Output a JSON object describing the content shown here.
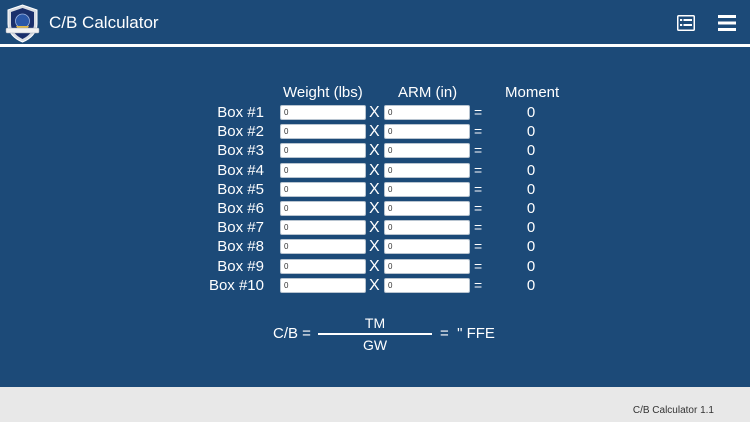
{
  "header": {
    "title": "C/B Calculator",
    "logo_icon": "air-force-shield-emblem",
    "list_icon": "list-view-icon",
    "menu_icon": "hamburger-menu-icon",
    "background_color": "#1c4a78"
  },
  "columns": {
    "weight": "Weight (lbs)",
    "arm": "ARM (in)",
    "moment": "Moment"
  },
  "rows": [
    {
      "label": "Box #1",
      "weight": "0",
      "arm": "0",
      "times": "X",
      "equals": "=",
      "moment": "0"
    },
    {
      "label": "Box #2",
      "weight": "0",
      "arm": "0",
      "times": "X",
      "equals": "=",
      "moment": "0"
    },
    {
      "label": "Box #3",
      "weight": "0",
      "arm": "0",
      "times": "X",
      "equals": "=",
      "moment": "0"
    },
    {
      "label": "Box #4",
      "weight": "0",
      "arm": "0",
      "times": "X",
      "equals": "=",
      "moment": "0"
    },
    {
      "label": "Box #5",
      "weight": "0",
      "arm": "0",
      "times": "X",
      "equals": "=",
      "moment": "0"
    },
    {
      "label": "Box #6",
      "weight": "0",
      "arm": "0",
      "times": "X",
      "equals": "=",
      "moment": "0"
    },
    {
      "label": "Box #7",
      "weight": "0",
      "arm": "0",
      "times": "X",
      "equals": "=",
      "moment": "0"
    },
    {
      "label": "Box #8",
      "weight": "0",
      "arm": "0",
      "times": "X",
      "equals": "=",
      "moment": "0"
    },
    {
      "label": "Box #9",
      "weight": "0",
      "arm": "0",
      "times": "X",
      "equals": "=",
      "moment": "0"
    },
    {
      "label": "Box #10",
      "weight": "0",
      "arm": "0",
      "times": "X",
      "equals": "=",
      "moment": "0"
    }
  ],
  "formula": {
    "label": "C/B =",
    "numerator": "TM",
    "denominator": "GW",
    "result": "=  \" FFE"
  },
  "footer": {
    "version": "C/B Calculator 1.1"
  }
}
